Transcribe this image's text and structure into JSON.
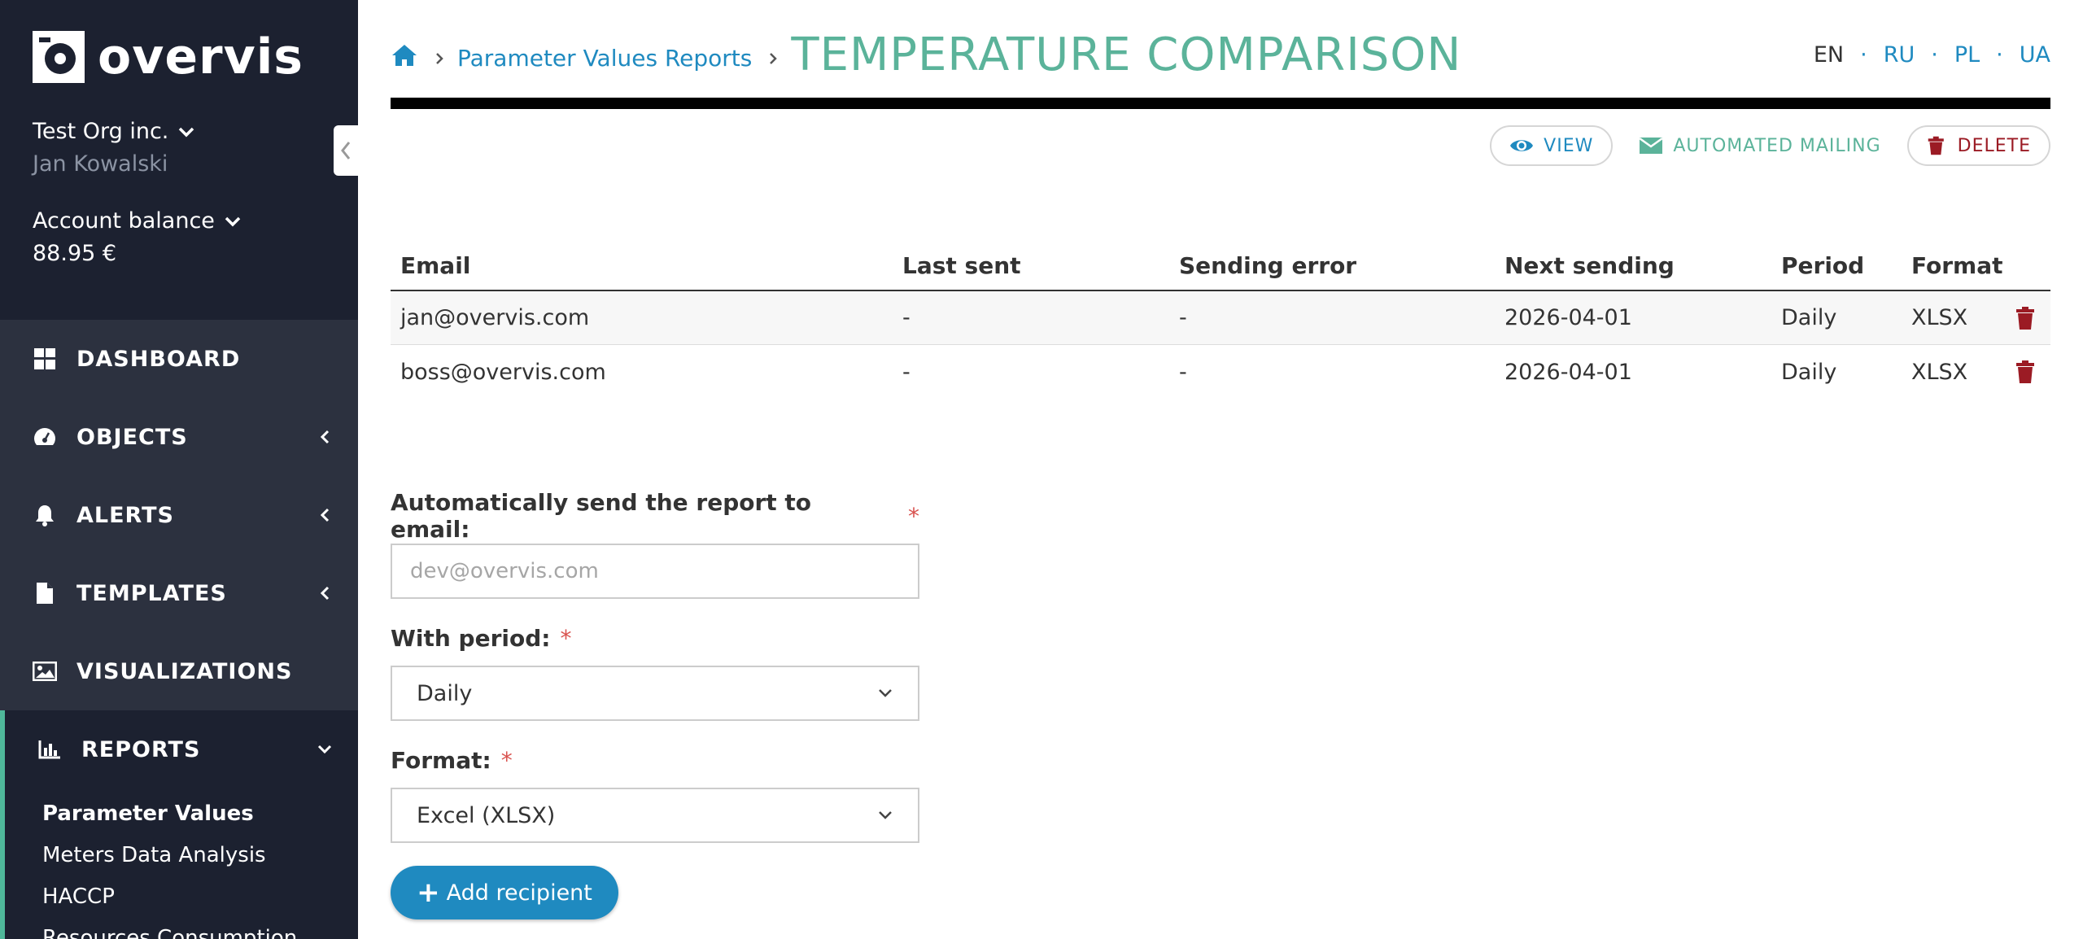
{
  "brand": {
    "name": "overvis",
    "accent": "#5bb39a",
    "link": "#1f8ac0",
    "sidebar_bg": "#1c2130",
    "danger": "#9b1b24"
  },
  "account": {
    "org": "Test Org inc.",
    "user": "Jan Kowalski",
    "balance_label": "Account balance",
    "balance_value": "88.95 €"
  },
  "nav": {
    "dashboard": "DASHBOARD",
    "objects": "OBJECTS",
    "alerts": "ALERTS",
    "templates": "TEMPLATES",
    "visualizations": "VISUALIZATIONS",
    "reports": "REPORTS",
    "reports_sub": [
      "Parameter Values",
      "Meters Data Analysis",
      "HACCP",
      "Resources Consumption"
    ]
  },
  "header": {
    "breadcrumb": "Parameter Values Reports",
    "title": "TEMPERATURE COMPARISON",
    "languages": [
      "EN",
      "RU",
      "PL",
      "UA"
    ],
    "current_language": "EN"
  },
  "actions": {
    "view": "VIEW",
    "mailing": "AUTOMATED MAILING",
    "delete": "DELETE"
  },
  "table": {
    "columns": [
      "Email",
      "Last sent",
      "Sending error",
      "Next sending",
      "Period",
      "Format"
    ],
    "rows": [
      {
        "email": "jan@overvis.com",
        "last_sent": "-",
        "error": "-",
        "next": "2026-04-01",
        "period": "Daily",
        "format": "XLSX"
      },
      {
        "email": "boss@overvis.com",
        "last_sent": "-",
        "error": "-",
        "next": "2026-04-01",
        "period": "Daily",
        "format": "XLSX"
      }
    ]
  },
  "form": {
    "email_label": "Automatically send the report to email:",
    "email_placeholder": "dev@overvis.com",
    "period_label": "With period:",
    "period_value": "Daily",
    "format_label": "Format:",
    "format_value": "Excel (XLSX)",
    "required_mark": "*",
    "add_button": "Add recipient",
    "add_icon": "+"
  }
}
